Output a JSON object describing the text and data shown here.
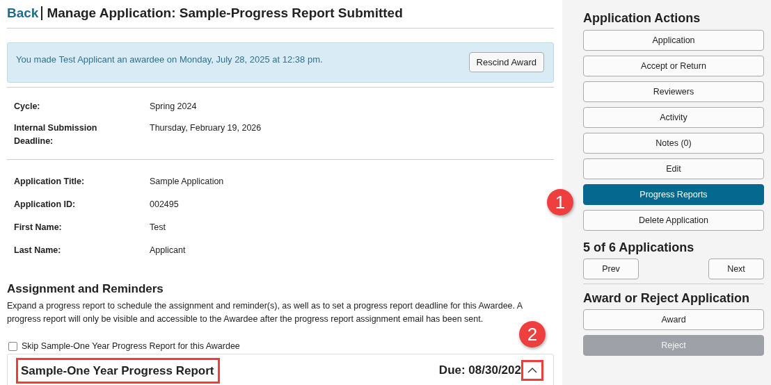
{
  "header": {
    "back_link": "Back",
    "title": "Manage Application: Sample-Progress Report Submitted"
  },
  "alert": {
    "message": "You made Test Applicant an awardee on Monday, July 28, 2025 at 12:38 pm.",
    "button": "Rescind Award"
  },
  "cycle_details": [
    {
      "label": "Cycle:",
      "value": "Spring 2024"
    },
    {
      "label": "Internal Submission Deadline:",
      "value": "Thursday, February 19, 2026"
    }
  ],
  "applicant_details": [
    {
      "label": "Application Title:",
      "value": "Sample Application"
    },
    {
      "label": "Application ID:",
      "value": "002495"
    },
    {
      "label": "First Name:",
      "value": "Test"
    },
    {
      "label": "Last Name:",
      "value": "Applicant"
    }
  ],
  "assignment": {
    "heading": "Assignment and Reminders",
    "description": "Expand a progress report to schedule the assignment and reminder(s), as well as to set a progress report deadline for this Awardee. A progress report will only be visible and accessible to the Awardee after the progress report assignment email has been sent.",
    "skip": {
      "label": "Skip Sample-One Year Progress Report for this Awardee",
      "checked": false
    },
    "report": {
      "title": "Sample-One Year Progress Report",
      "due": "Due: 08/30/202",
      "expanded": true,
      "title_highlighted": true,
      "toggle_highlighted": true
    }
  },
  "sidebar": {
    "heading": "Application Actions",
    "actions": [
      {
        "label": "Application",
        "selected": false
      },
      {
        "label": "Accept or Return",
        "selected": false
      },
      {
        "label": "Reviewers",
        "selected": false
      },
      {
        "label": "Activity",
        "selected": false
      },
      {
        "label": "Notes (0)",
        "selected": false
      },
      {
        "label": "Edit",
        "selected": false
      },
      {
        "label": "Progress Reports",
        "selected": true
      },
      {
        "label": "Delete Application",
        "selected": false
      }
    ],
    "counter": "5 of 6 Applications",
    "prev": "Prev",
    "next": "Next",
    "decision_heading": "Award or Reject Application",
    "decisions": [
      {
        "label": "Award",
        "disabled": false
      },
      {
        "label": "Reject",
        "disabled": true
      }
    ]
  },
  "callouts": [
    {
      "number": "1"
    },
    {
      "number": "2"
    }
  ]
}
